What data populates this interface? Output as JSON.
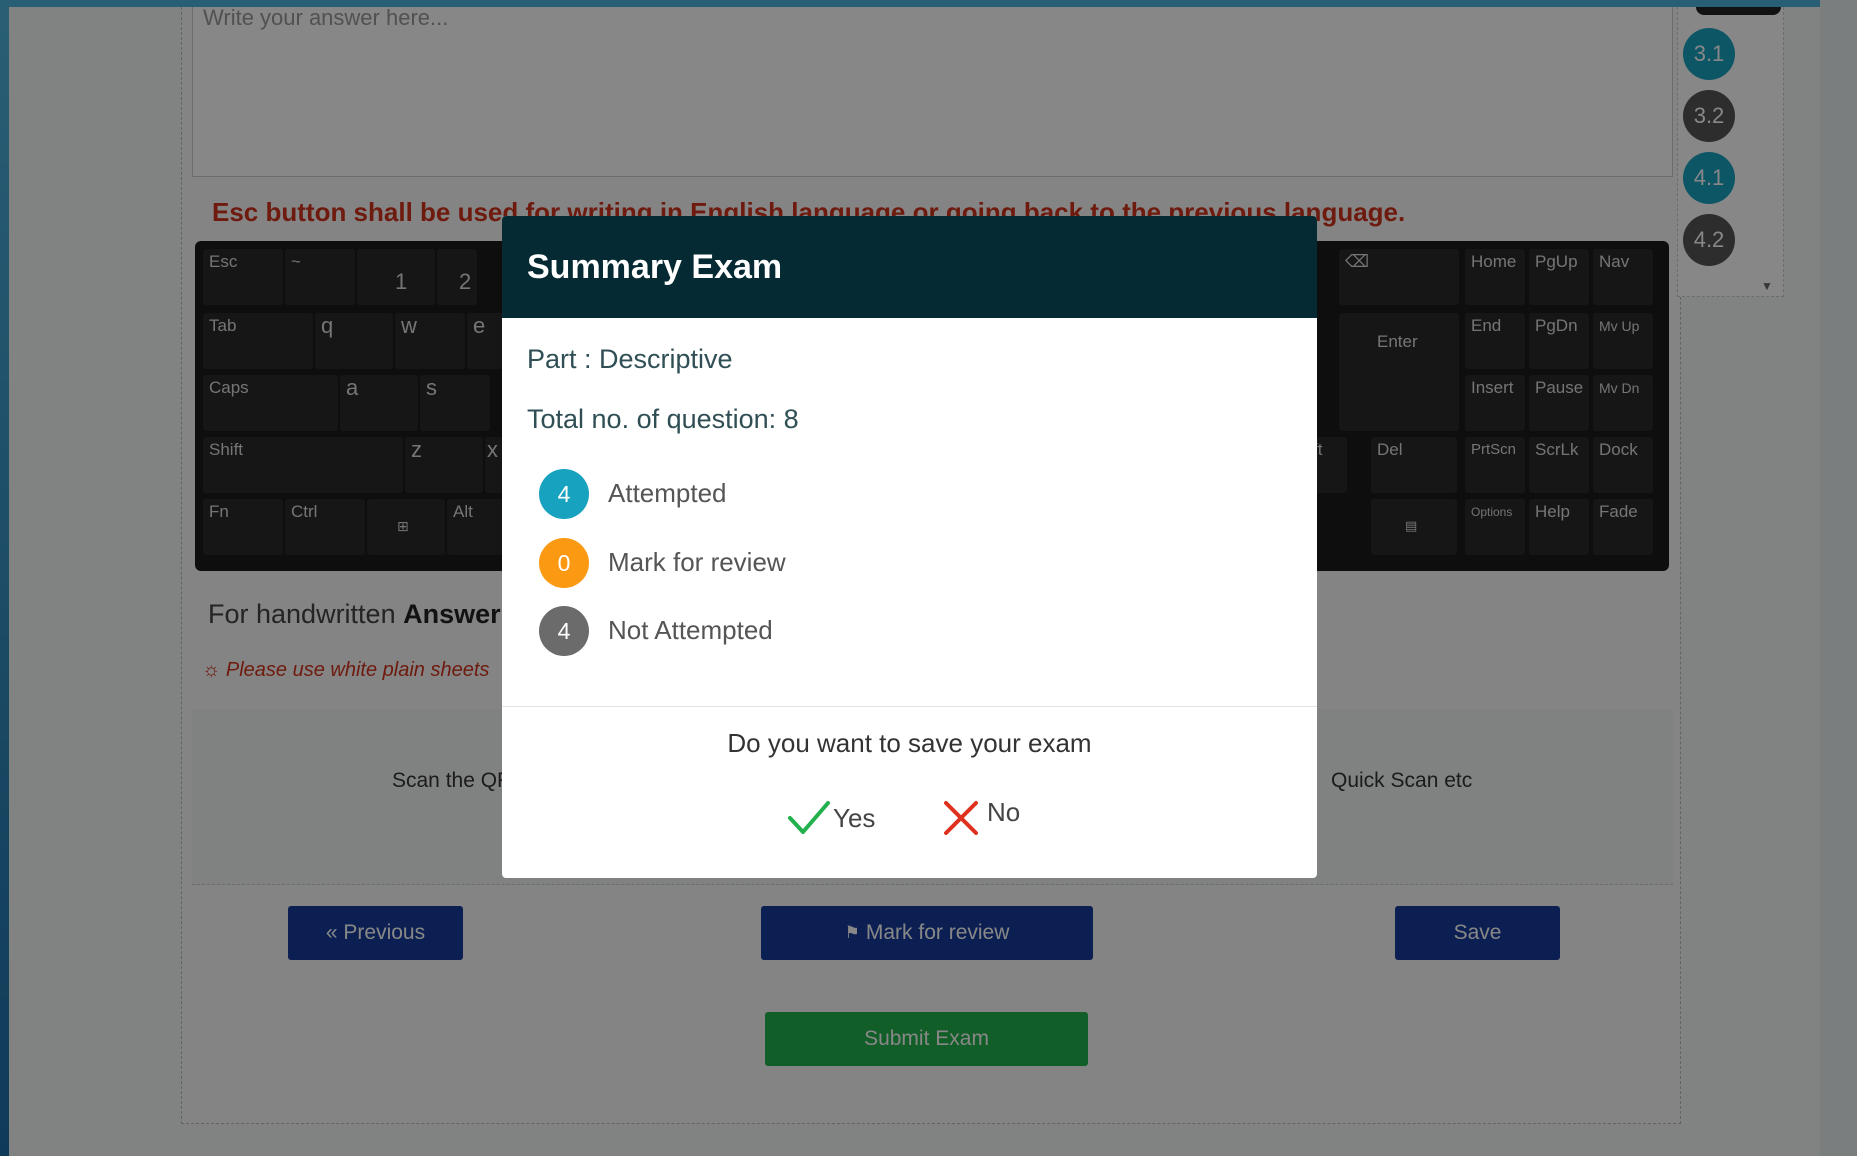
{
  "answer_placeholder": "Write your answer here...",
  "esc_note": "Esc button shall be used for writing in English language or going back to the previous language.",
  "keyboard": {
    "keys": [
      "Esc",
      "Tab",
      "Caps",
      "Shift",
      "Fn",
      "Ctrl",
      "Alt",
      "q",
      "w",
      "e",
      "a",
      "s",
      "z",
      "x",
      "1",
      "2",
      "Enter",
      "Del",
      "Home",
      "PgUp",
      "Nav",
      "End",
      "PgDn",
      "Mv Up",
      "Insert",
      "Pause",
      "Mv Dn",
      "PrtScn",
      "ScrLk",
      "Dock",
      "Options",
      "Help",
      "Fade"
    ]
  },
  "handwritten": {
    "prefix": "For handwritten ",
    "bold": "Answer"
  },
  "hint": "Please use white plain sheets",
  "scan": {
    "left": "Scan the QR",
    "right": "Quick Scan etc"
  },
  "buttons": {
    "previous": "« Previous",
    "mark_review": "Mark for review",
    "save": "Save",
    "submit": "Submit Exam"
  },
  "question_panel": [
    "3.1",
    "3.2",
    "4.1",
    "4.2"
  ],
  "modal": {
    "title": "Summary Exam",
    "part": "Part : Descriptive",
    "total": "Total no. of question: 8",
    "stats": [
      {
        "count": "4",
        "label": "Attempted",
        "color": "#17a2c0"
      },
      {
        "count": "0",
        "label": "Mark for review",
        "color": "#fb9a12"
      },
      {
        "count": "4",
        "label": "Not Attempted",
        "color": "#6b6b6b"
      }
    ],
    "question": "Do you want to save your exam",
    "yes": "Yes",
    "no": "No"
  }
}
